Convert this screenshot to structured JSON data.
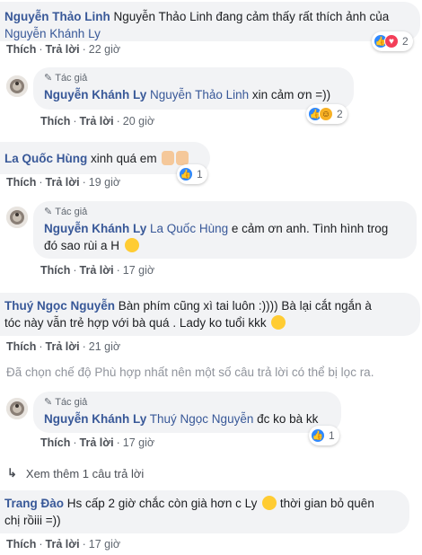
{
  "comments": [
    {
      "author": "Nguyễn Thảo Linh",
      "text": "Nguyễn Thảo Linh đang cảm thấy rất thích ảnh của",
      "mention": "Nguyễn Khánh Ly",
      "like": "Thích",
      "reply": "Trả lời",
      "time": "22 giờ",
      "reaction_count": "2"
    },
    {
      "author_tag": "Tác giả",
      "author": "Nguyễn Khánh Ly",
      "mention": "Nguyễn Thảo Linh",
      "text": "xin cảm ơn =))",
      "like": "Thích",
      "reply": "Trả lời",
      "time": "20 giờ",
      "reaction_count": "2"
    },
    {
      "author": "La Quốc Hùng",
      "text": "xinh quá em",
      "like": "Thích",
      "reply": "Trả lời",
      "time": "19 giờ",
      "reaction_count": "1"
    },
    {
      "author_tag": "Tác giả",
      "author": "Nguyễn Khánh Ly",
      "mention": "La Quốc Hùng",
      "text": "e cảm ơn anh. Tình hình trog",
      "text2": "đó sao rùi a H",
      "like": "Thích",
      "reply": "Trả lời",
      "time": "17 giờ"
    },
    {
      "author": "Thuý Ngọc Nguyễn",
      "text": "Bàn phím cũng xì tai luôn :)))) Bà lại cắt ngắn à",
      "text2": "tóc này vẫn trẻ hợp với bà quá . Lady ko tuổi kkk",
      "like": "Thích",
      "reply": "Trả lời",
      "time": "21 giờ"
    },
    {
      "author_tag": "Tác giả",
      "author": "Nguyễn Khánh Ly",
      "mention": "Thuý Ngọc Nguyễn",
      "text": "đc ko bà kk",
      "like": "Thích",
      "reply": "Trả lời",
      "time": "17 giờ",
      "reaction_count": "1"
    },
    {
      "author": "Trang Đào",
      "text": "Hs cấp 2 giờ chắc còn già hơn c Ly",
      "text2": "thời gian bỏ quên",
      "text3": "chị rồiii =))",
      "like": "Thích",
      "reply": "Trả lời",
      "time": "17 giờ"
    }
  ],
  "filter_notice": "Đã chọn chế độ Phù hợp nhất nên một số câu trả lời có thể bị lọc ra.",
  "view_more": "Xem thêm 1 câu trả lời",
  "colors": {
    "name": "#385898",
    "bubble": "#f2f3f5",
    "like": "#2d88ff",
    "love": "#f33e58"
  }
}
